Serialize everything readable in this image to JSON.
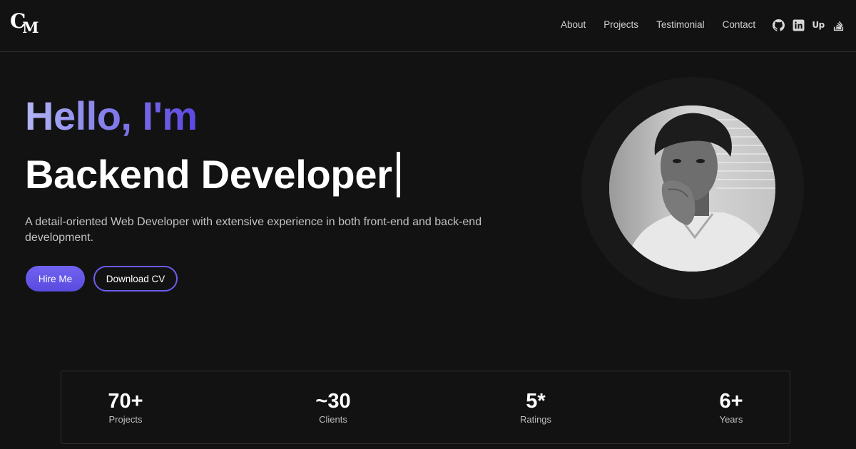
{
  "brand": {
    "logo_c": "C",
    "logo_m": "M"
  },
  "nav": {
    "items": [
      "About",
      "Projects",
      "Testimonial",
      "Contact"
    ]
  },
  "socials": [
    "github-icon",
    "linkedin-icon",
    "upwork-icon",
    "stackoverflow-icon"
  ],
  "upwork_text": "Up",
  "hero": {
    "greeting": "Hello, I'm",
    "role": "Backend Developer",
    "tagline": "A detail-oriented Web Developer with extensive experience in both front-end and back-end development.",
    "hire_label": "Hire Me",
    "cv_label": "Download CV"
  },
  "stats": [
    {
      "value": "70+",
      "label": "Projects"
    },
    {
      "value": "~30",
      "label": "Clients"
    },
    {
      "value": "5*",
      "label": "Ratings"
    },
    {
      "value": "6+",
      "label": "Years"
    }
  ],
  "colors": {
    "background": "#121212",
    "accent": "#6b5df0",
    "gradient_start": "#b3b6f4",
    "gradient_end": "#5b48e0"
  }
}
